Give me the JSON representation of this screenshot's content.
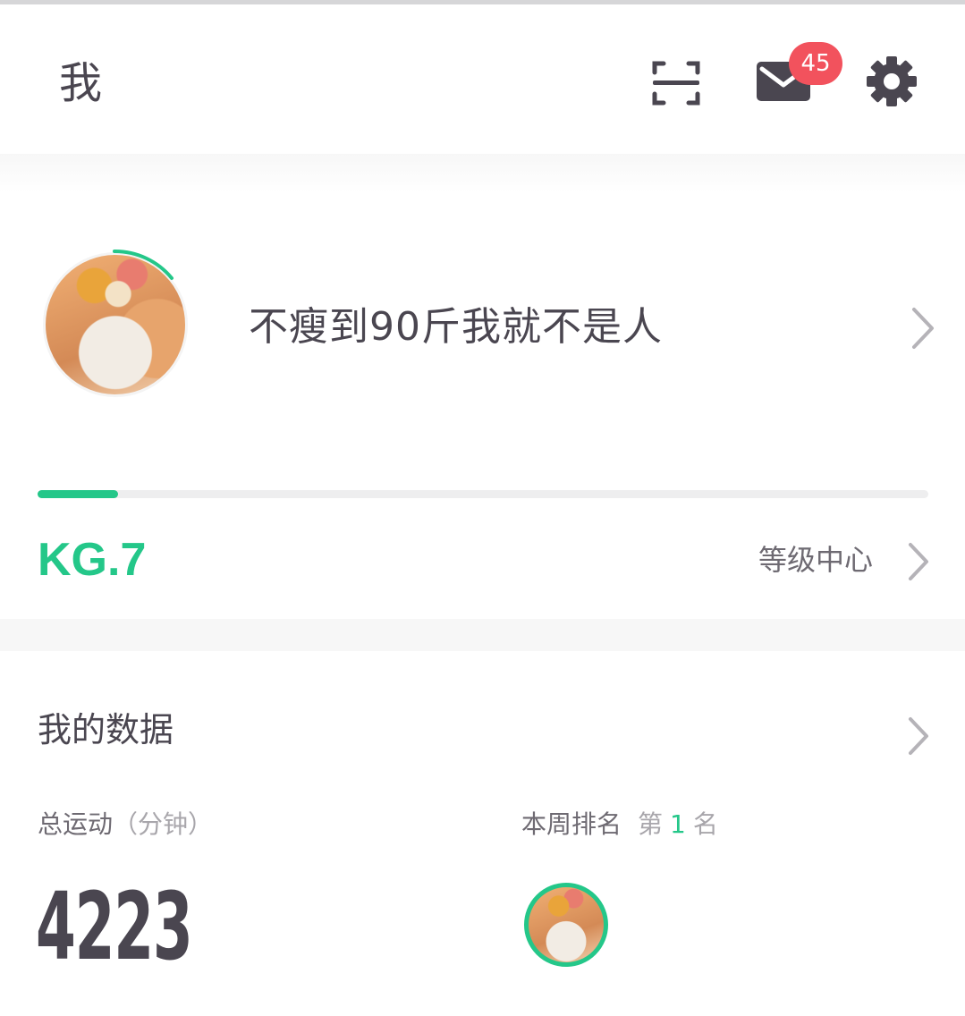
{
  "header": {
    "title": "我",
    "icons": {
      "scan": "scan-icon",
      "mail": "mail-icon",
      "settings": "gear-icon"
    },
    "unread_count": "45"
  },
  "profile": {
    "nickname": "不瘦到90斤我就不是人",
    "avatar": "cat-avatar"
  },
  "level": {
    "label": "KG.7",
    "progress": 0.09,
    "center_label": "等级中心"
  },
  "my_data": {
    "title": "我的数据",
    "total_exercise_label": "总运动",
    "total_exercise_unit": "（分钟）",
    "total_exercise_value": "4223",
    "weekly_rank_label": "本周排名",
    "rank_prefix": "第",
    "rank_number": "1",
    "rank_suffix": "名"
  },
  "colors": {
    "accent": "#24c789",
    "badge": "#f2525d",
    "text": "#4a4650"
  }
}
